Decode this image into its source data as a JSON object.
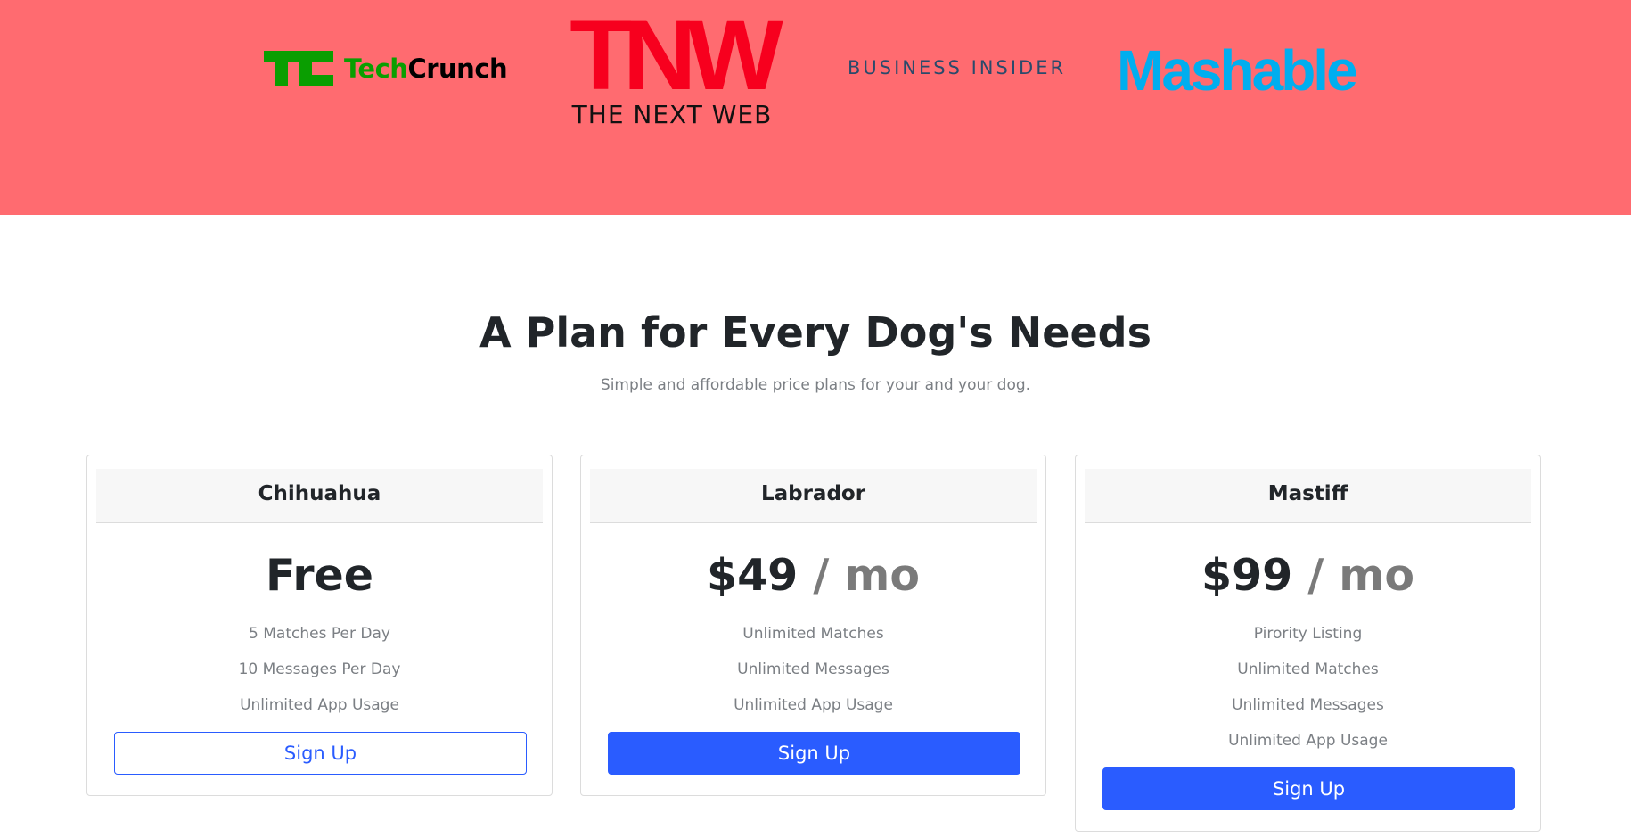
{
  "press": {
    "background": "#ff6b70",
    "logos": {
      "techcrunch": {
        "left": "Tech",
        "right": "Crunch"
      },
      "tnw": {
        "big": "TNW",
        "small": "THE NEXT WEB"
      },
      "business_insider": "BUSINESS INSIDER",
      "mashable": "Mashable"
    }
  },
  "pricing": {
    "heading": "A Plan for Every Dog's Needs",
    "subheading": "Simple and affordable price plans for your and your dog.",
    "plans": [
      {
        "name": "Chihuahua",
        "price": "Free",
        "period": "",
        "features": [
          "5 Matches Per Day",
          "10 Messages Per Day",
          "Unlimited App Usage"
        ],
        "button": "Sign Up",
        "button_style": "outline"
      },
      {
        "name": "Labrador",
        "price": "$49",
        "period": " / mo",
        "features": [
          "Unlimited Matches",
          "Unlimited Messages",
          "Unlimited App Usage"
        ],
        "button": "Sign Up",
        "button_style": "solid"
      },
      {
        "name": "Mastiff",
        "price": "$99",
        "period": " / mo",
        "features": [
          "Pirority Listing",
          "Unlimited Matches",
          "Unlimited Messages",
          "Unlimited App Usage"
        ],
        "button": "Sign Up",
        "button_style": "solid"
      }
    ],
    "accent": "#2a5cff"
  }
}
